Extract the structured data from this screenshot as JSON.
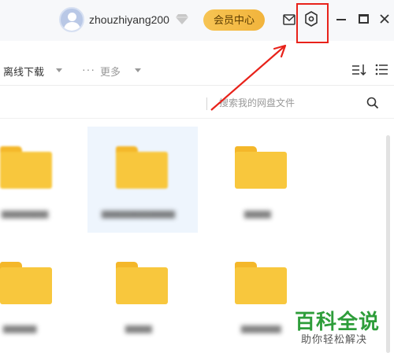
{
  "titlebar": {
    "username": "zhouzhiyang200",
    "vip_button": "会员中心"
  },
  "toolbar": {
    "offline_download": "离线下载",
    "more_dots": "···",
    "more": "更多"
  },
  "search": {
    "placeholder": "搜索我的网盘文件"
  },
  "files": {
    "items": [
      {
        "name": "▆▆▆▆▆▆▆"
      },
      {
        "name": "▆▆▆▆▆▆▆▆▆▆▆"
      },
      {
        "name": "▆▆▆▆"
      },
      {
        "name": "▆▆▆▆▆"
      },
      {
        "name": "▆▆▆▆"
      },
      {
        "name": "▆▆▆▆▆▆"
      }
    ]
  },
  "watermark": {
    "title": "百科全说",
    "subtitle": "助你轻松解决"
  },
  "colors": {
    "accent_red": "#e8221a",
    "folder_yellow": "#f8c73d",
    "vip_gold": "#f2b43c",
    "watermark_green": "#2e9d3a"
  }
}
